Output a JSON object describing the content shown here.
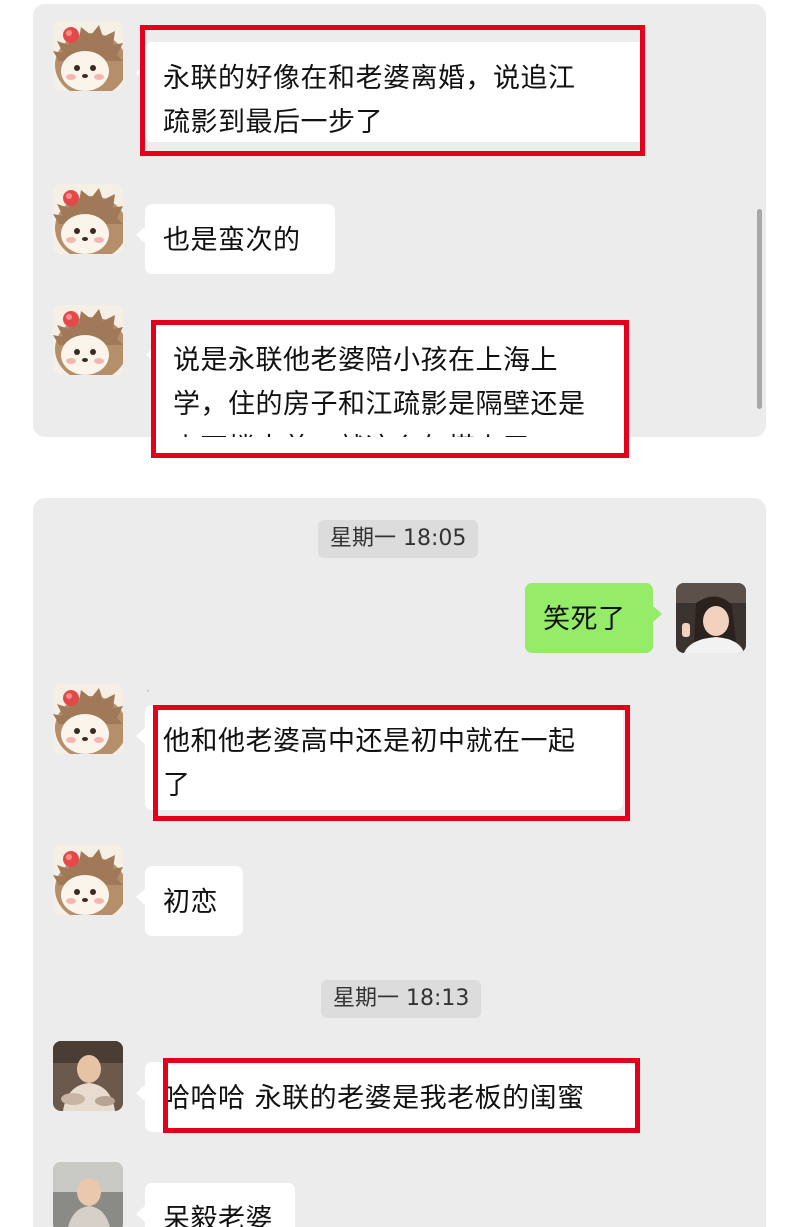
{
  "panel_top": {
    "messages": [
      {
        "text": "永联的好像在和老婆离婚，说追江\n疏影到最后一步了",
        "highlighted": true
      },
      {
        "text": "也是蛮次的",
        "highlighted": false
      },
      {
        "text": "说是永联他老婆陪小孩在上海上\n学，住的房子和江疏影是隔壁还是\n上下楼来着，就这么勾搭上了",
        "highlighted": true
      }
    ]
  },
  "panel_bottom": {
    "timestamps": [
      "星期一 18:05",
      "星期一 18:13"
    ],
    "messages": [
      {
        "text": "笑死了",
        "side": "right",
        "highlighted": false
      },
      {
        "text": "他和他老婆高中还是初中就在一起\n了",
        "side": "left",
        "highlighted": true
      },
      {
        "text": "初恋",
        "side": "left",
        "highlighted": false
      },
      {
        "text": "哈哈哈 永联的老婆是我老板的闺蜜",
        "side": "left",
        "highlighted": true
      },
      {
        "text": "呆毅老婆",
        "side": "left",
        "highlighted": false
      }
    ]
  },
  "icons": {
    "hedgehog_avatar": "hedgehog-avatar-icon",
    "photo_avatar": "user-photo-avatar-icon",
    "self_avatar": "self-photo-avatar-icon"
  },
  "colors": {
    "chat_background": "#ececec",
    "bubble_incoming": "#ffffff",
    "bubble_outgoing": "#95ec69",
    "highlight_box": "#e3001b"
  }
}
